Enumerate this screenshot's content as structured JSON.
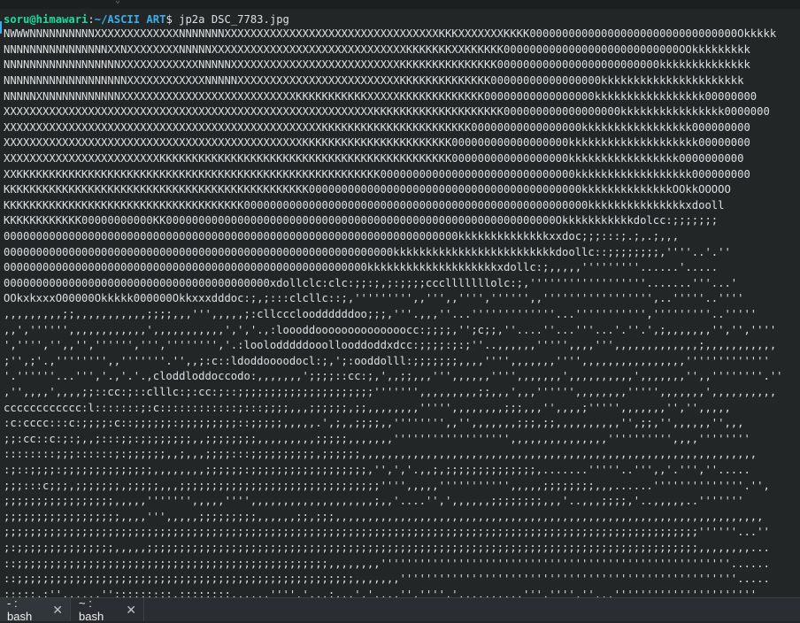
{
  "prompt": {
    "user_host": "soru@himawari",
    "separator": ":",
    "path": "~/ASCII ART",
    "dollar": "$",
    "command": " jp2a DSC_7783.jpg"
  },
  "ascii_lines": [
    "NWWWNNNNNNNNNNXXXXXXXXXXXXXNNNNNNNXXXXXXXXXXXXXXXXXXXXXXXXXXXXXXXXXKKKXXXXXXXKKKK00000000000000000000000000000000Okkkkk",
    "NNNNNNNNNNNNNNNNXXNXXXXXXXXNNNNNXXXXXXXXXXXXXXXXXXXXXXXXXXXXXXKKKKKKKXXKKKKKK000000000000000000000000000OOkkkkkkkkk",
    "NNNNNNNNNNNNNNNNNNXXXXXXXXXXXXNNNNNXXXXXXXXXXXXXXXXXXXXXXXXXXKKKKKKKKKKKKKKK0000000000000000000000000kkkkkkkkkkkkkk",
    "NNNNNNNNNNNNNNNNNNNXXXXXXXXXXXXNNNNNXXXXXXXXXXXXXXXXXXXXXXXXXKKKKKKKKKKKKKK00000000000000000kkkkkkkkkkkkkkkkkkkkkk",
    "NNNNNXNNNNNNNNNNNNXXXXXXXXXXXXXXXXXXXXXXXXXXXKKKKKKKKKKKXXXXXKKKKKKKKKKKKK00000000000000000kkkkkkkkkkkkkkkkk00000000",
    "XXXXXXXXXXXXXXXXXXXXXXXXXXXXXXXXXXXXXXXXXXXXXXXXXXXXXXXXXKKKKKKKKKKKKKKKKKKKK000000000000000000kkkkkkkkkkkkkkkk0000000",
    "XXXXXXXXXXXXXXXXXXXXXXXXXXXXXXXXXXXXXXXXXXXXXXXXXKKKKKKKKKKKKKKKKKKKKKKK00000000000000000kkkkkkkkkkkkkkkkk000000000",
    "XXXXXXXXXXXXXXXXXXXXXXXXXXXXXXXXXXXXXXXXXXXXXXKKKKKKKKKKKKKKKKKKKKKKK000000000000000000kkkkkkkkkkkkkkkkkkkk00000000",
    "XXXXXXXXXXXXXXXXXXXXXXXXKKKKKKKKKKKKKKKKKKKKKKKKKKKKKKKKKKKKKKKKKKKKK000000000000000000kkkkkkkkkkkkkkkkk0000000000",
    "XXKKKKKKKKKKKKKKKKKKKKKKKKKKKKKKKKKKKKKKKKKKKKKKKKKKKKKKKK000000000000000000000000000000kkkkkkkkkkkkkkkkkk000000000",
    "KKKKKKKKKKKKKKKKKKKKKKKKKKKKKKKKKKKKKKKKKKKKKKK000000000000000000000000000000000000000000kkkkkkkkkkkkkkOOkkOOOOO",
    "KKKKKKKKKKKKKKKKKKKKKKKKKKKKKKKKKKKKK00000000000000000000000000000000000000000000000000000kkkkkkkkkkkkkkkxdooll",
    "KKKKKKKKKKKK00000000000KK000000000000000000000000000000000000000000000000000000000000Okkkkkkkkkkkdolcc:;;;;;;;",
    "0000000000000000000000000000000000000000000000000000000000000000000000kkkkkkkkkkkkkkxxdoc;;;:::;.;,.;,,,",
    "000000000000000000000000000000000000000000000000000000000000kkkkkkkkkkkkkkkkkkkkkkkkkdoollc::;;;;;;;;,''''..'.''",
    "00000000000000000000000000000000000000000000000000000000kkkkkkkkkkkkkkkkkkkkxdollc:;,,,,,'''''''''......'.....",
    "00000000000000000000000000000000000000000xdollclc:clc:;;:;,;:;;;;ccclllllllolc:;,''''''''''''''''''.......'''...'",
    "OOkxkxxxO00000Okkkkk000000Okkxxxdddoc:;,;:::clcllc::;,''''''''',,''',,'''','''''',,''''''''''''''''',..'''''..''''",
    ",,,,,,,,,;;,,,,,,,,,,,;;;;,,,''',,,,,;:cllccclooddddddoo;;;,'''.,,,''...'''''''''''''...''''''''''','''''''''..'''''",
    ",,','''''',,,,,,,,,,,,',,,,,,,,,,,',','.,:loooddoooooooooooooocc:;;;;,'';c;;,''....''...'''...'.''.',;,,,,,,,'','',''''",
    "','''','',,'','''''',''','''''''','.:loolodddddooollooddoddxdcc:;;;;:;:;''..,,,,,,''''',,,,''',,,,,,,,,,,,,;,,,,,,,,,,,",
    ";'',;'.,'''''''',,'''''''.'',,;:c::ldoddoooodocl:;,';:ooddolll:;;;;;;;,,,,'''',,,,,,,'''',,,,,,,,,,,,,,,,'''''''''''''",
    "'.''''''...''','.,'.'.,cloddloddoccodo:,,,,,,,';;;;::cc:;,',,;;,,,''',,,,,,'''',,,,,,,',,,,,,,,,,',,,,,,,'',,''''''''.''",
    ",'',,,,',,,,;;::cc:;::clllc:;:cc:;::;;;;;;;;;;;;;;;;;;;;;''''''',,,,,,,,,;;,,,',,,'''''',,,,,,,,''''',,,,,,,',,,,,,,,,,",
    "cccccccccccc:l:::::::;:c::::::::::::;:::;;;;,,,;;;;;;,;;,,,,,,,,''''',,,,,,,,;;;,,,'',,,,;''''',,,,,,,'','',,,,,",
    ":c:cccc:::c:;;;;:c::;;;;;;:;;;;;;;;;::;;;;;,,,,,.',;,,;;;;,,'''''''',,'',,,,,,,;;;,;;,,,,,,,,,,'',;;,'',,,,,,'',,,",
    ";;:cc::c:;:;,,;:::;;:;;;;;;;;,,;;;;;;;;,,,,,,,,,;;;;;,,,,,,,'''''''''''''''''',,,,,,,,,,,,,,,'''''''''',,,,''''''''",
    "::::::::;;;::::::;:;;;;;;,,;,,,;;;;:::;;;;;;;;;;,;;;;;;,,,,,,,,,,,,,,,,,,,,,,,,,,,,,,,,,,,,,,,,,,,,,,,,,,,,,,,,,,,,,",
    ":;::;;;;:;;;;;;;;;;;;;;,,,,,,,,;;;;;;:;;;;;;;;;;;;;;;;;;,'',','.,,;,;;;;;;;;;;;;;;,.......'''''..''',,'.''',''.....",
    ";;;:::c;;;,;;;;;;;,;;;;;,,,;;;;;;;;;;;;;;;;;;;;;;;;;;;;;;;'''',,,,,''''''''''',,,,,;;;;;;;;,,,......''''''''''''''.'',",
    ";;;;;;;;;;;;;;;;;,,,,,''''''',,,,,'''',,,,,,,,,,,,,,,,,,,;,,'....'',',,,,,,;;;;;;;;,,,'..,,,;;;;,'..,,,,,..'''''''",
    ";;;;;;;;;;;;;;;;;;,,,,''',,,,,;;;;;;;;;,,,,,,;;,;;;,,,,,,,,,,,,,,,,,,,,,,,,,,,,,,,,,,,,,,,,,,,,,,,,,,,,,,,,,,,,,,,,,,",
    ";;;;;;;;;;;;;;;;;;;;;;;;;;;;;;;;;;;;;;;;;;;;;;;;;;;;;;;;;;;;;;;;;;;;;;;;;;;;;;;;;;;;;;;;;;;;;;;;;;;;;;;;;;;''''''...''",
    ";:;;;;;;;;;;;;;;;,,,,,;;;;;;;;;;;;;;;;;;;;;;;;;;;;;;;;;;;;;;;;;;;;;;;;;;;;;;;;;;;;;;;;;;;;;;;;;;;;;;;;;;;;;,,,,,,,,...",
    "::;;;;;;;;;;;;;;;;;;;;;;;;;;;;;;;;;;;;;;;;;;;;;;;;,,,,,,,,''''''''''''''''''''''''''''''''''''''''''''''''''''''......",
    "::;;;;;;;;;;;;;;;;;;;;;;;;;;;;;;;;;;;;;;;;;;;;;;;;;;;;,,,,,,,''''''''''''''''''''''''''''''''''''''''''''''''''''.....",
    ";::;;,;'',,,,,,'';;;;;;:;;,;;;;;;;;,,,,,,''''.',,,;,,,',',,,,'','''',',,,,,,,,,,''',''''.''...''''''''''''''''''''''"
  ],
  "tabs": [
    {
      "label": "- : bash"
    },
    {
      "label": "~ : bash"
    }
  ]
}
